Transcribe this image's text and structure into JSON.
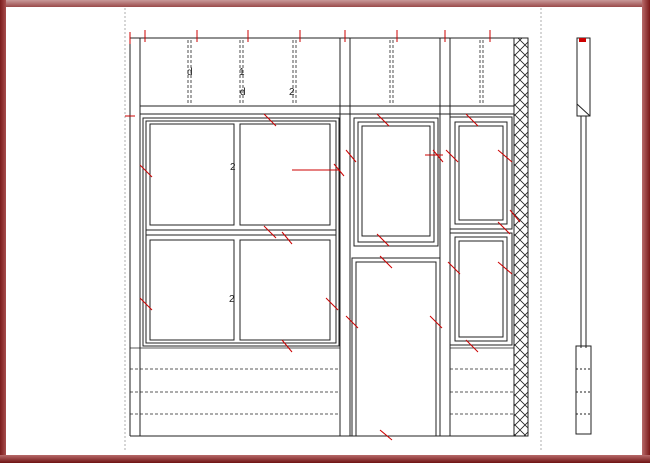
{
  "drawing": {
    "panel_labels": {
      "upper_left": "2",
      "lower_left": "2",
      "transom": "2",
      "tag_a": "d",
      "tag_b": "1",
      "tag_c": "d"
    }
  },
  "colors": {
    "frame_dark": "#7a1818",
    "frame_light": "#c99a9a",
    "line": "#222222",
    "dim_mark": "#cc0000",
    "guide": "#999999"
  }
}
